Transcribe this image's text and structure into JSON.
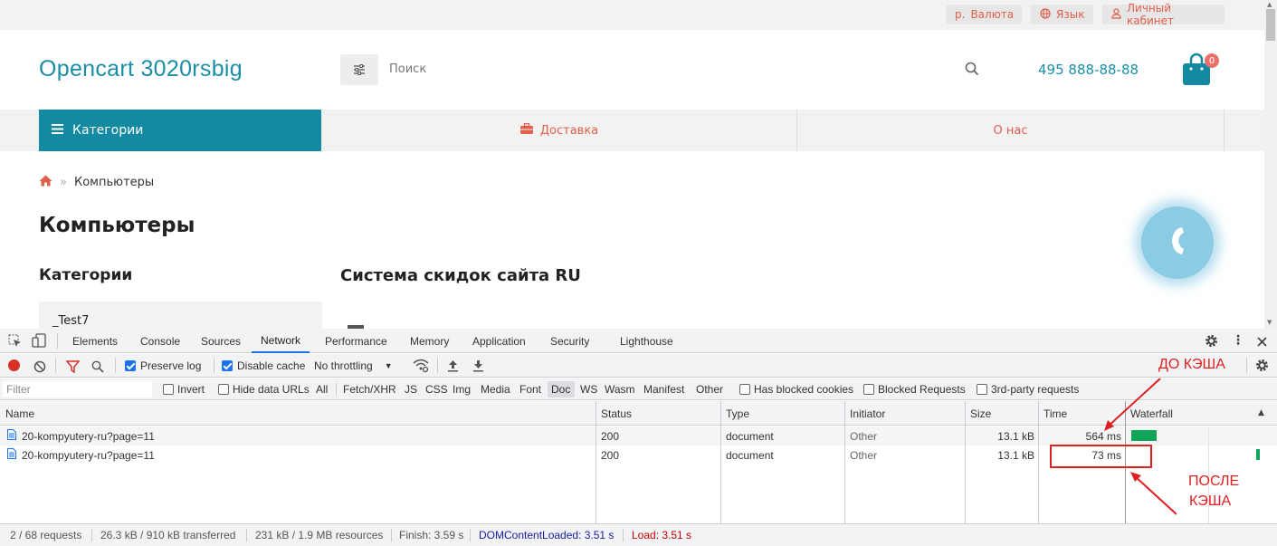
{
  "site": {
    "topbar": {
      "currency_symbol": "р.",
      "currency": "Валюта",
      "language": "Язык",
      "account": "Личный кабинет"
    },
    "logo": "Opencart 3020rsbig",
    "search_placeholder": "Поиск",
    "phone": "495 888-88-88",
    "cart_count": "0",
    "nav": {
      "categories": "Категории",
      "delivery": "Доставка",
      "about": "О нас"
    },
    "breadcrumb": {
      "current": "Компьютеры"
    },
    "page_title": "Компьютеры",
    "sidebar_title": "Категории",
    "content_title": "Система скидок сайта RU",
    "category_item": "_Test7"
  },
  "devtools": {
    "tabs": [
      "Elements",
      "Console",
      "Sources",
      "Network",
      "Performance",
      "Memory",
      "Application",
      "Security",
      "Lighthouse"
    ],
    "active_tab": "Network",
    "toolbar": {
      "preserve_log": "Preserve log",
      "disable_cache": "Disable cache",
      "throttling": "No throttling"
    },
    "filter": {
      "placeholder": "Filter",
      "invert": "Invert",
      "hide_data_urls": "Hide data URLs",
      "types": [
        "All",
        "Fetch/XHR",
        "JS",
        "CSS",
        "Img",
        "Media",
        "Font",
        "Doc",
        "WS",
        "Wasm",
        "Manifest",
        "Other"
      ],
      "selected_type": "Doc",
      "has_blocked_cookies": "Has blocked cookies",
      "blocked_requests": "Blocked Requests",
      "third_party": "3rd-party requests"
    },
    "columns": [
      "Name",
      "Status",
      "Type",
      "Initiator",
      "Size",
      "Time",
      "Waterfall"
    ],
    "rows": [
      {
        "name": "20-kompyutery-ru?page=11",
        "status": "200",
        "type": "document",
        "initiator": "Other",
        "size": "13.1 kB",
        "time": "564 ms"
      },
      {
        "name": "20-kompyutery-ru?page=11",
        "status": "200",
        "type": "document",
        "initiator": "Other",
        "size": "13.1 kB",
        "time": "73 ms"
      }
    ],
    "status": {
      "requests": "2 / 68 requests",
      "transferred": "26.3 kB / 910 kB transferred",
      "resources": "231 kB / 1.9 MB resources",
      "finish": "Finish: 3.59 s",
      "dcl": "DOMContentLoaded: 3.51 s",
      "load": "Load: 3.51 s"
    },
    "colors": {
      "accent": "#1a73e8",
      "dcl": "#1a1aa6",
      "load": "#c80000",
      "waterfall_bar": "#0ea55a"
    }
  },
  "annotations": {
    "before": "ДО КЭША",
    "after_line1": "ПОСЛЕ",
    "after_line2": "КЭША"
  }
}
